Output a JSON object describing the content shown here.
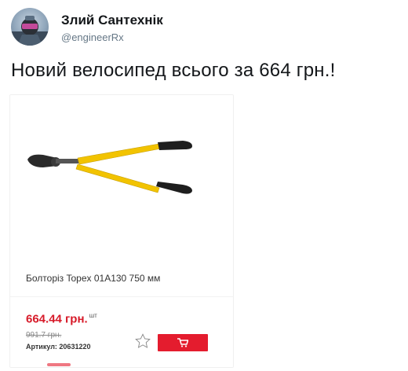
{
  "tweet": {
    "author_name": "Злий Сантехнік",
    "author_handle": "@engineerRx",
    "text": "Новий велосипед всього за 664 грн.!"
  },
  "product": {
    "title": "Болторіз Topex 01A130 750 мм",
    "price": "664.44 грн.",
    "unit": "шт",
    "old_price": "991.7 грн.",
    "article": "Артикул: 20631220",
    "image_icon": "bolt-cutter",
    "favorite_icon": "star-outline",
    "cart_icon": "shopping-cart"
  },
  "colors": {
    "accent_red": "#e41c2e",
    "price_red": "#d71a29",
    "handle_yellow": "#f2c300"
  }
}
